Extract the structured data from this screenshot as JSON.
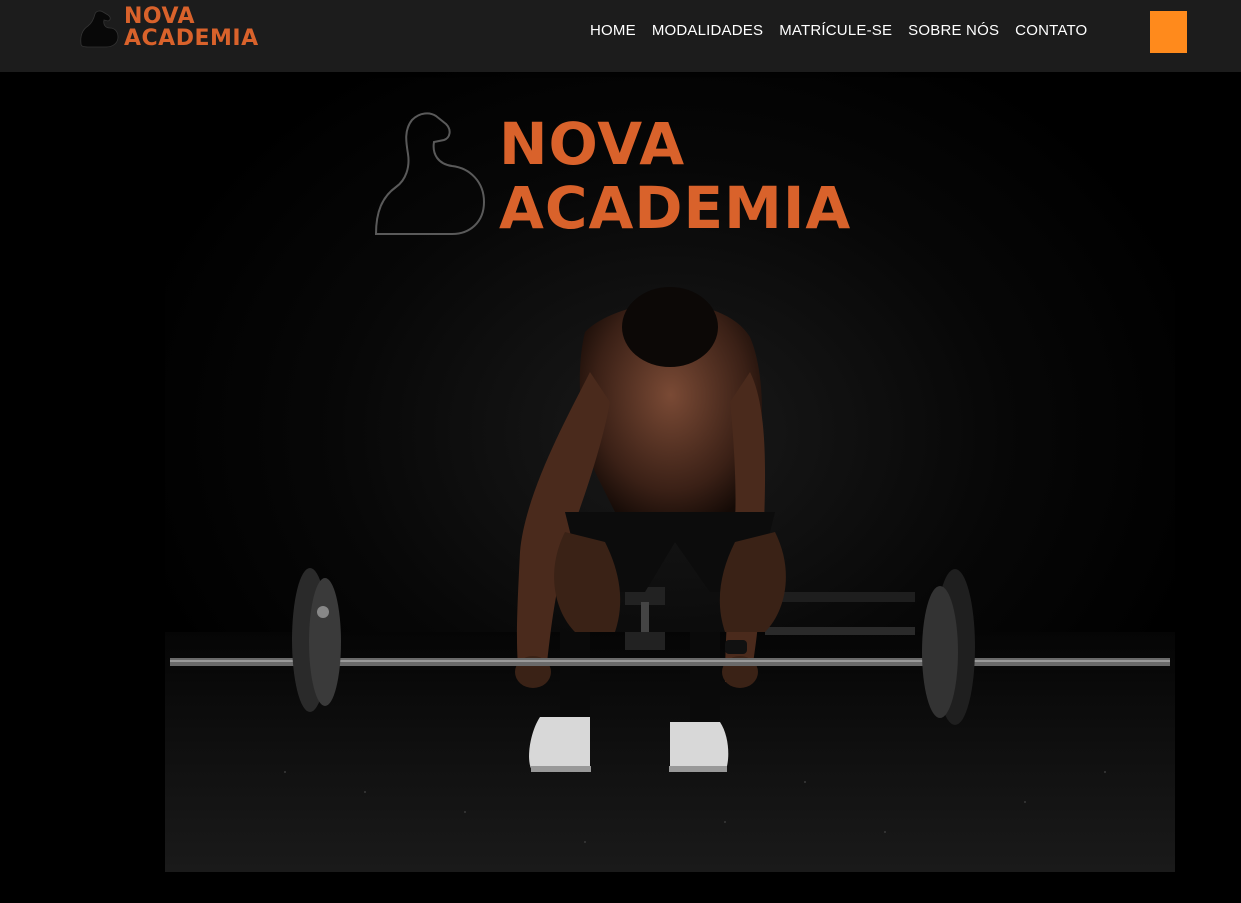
{
  "brand": {
    "line1": "NOVA",
    "line2": "ACADEMIA",
    "accent_color": "#d9622b",
    "icon": "flexed-arm-icon"
  },
  "nav": {
    "items": [
      {
        "label": "HOME"
      },
      {
        "label": "MODALIDADES"
      },
      {
        "label": "MATRÍCULE-SE"
      },
      {
        "label": "SOBRE NÓS"
      },
      {
        "label": "CONTATO"
      }
    ],
    "toggle_color": "#ff8a1c",
    "background": "#1c1c1c"
  },
  "hero": {
    "logo_line1": "NOVA",
    "logo_line2": "ACADEMIA",
    "photo": "man-deadlifting-barbell-photo"
  }
}
